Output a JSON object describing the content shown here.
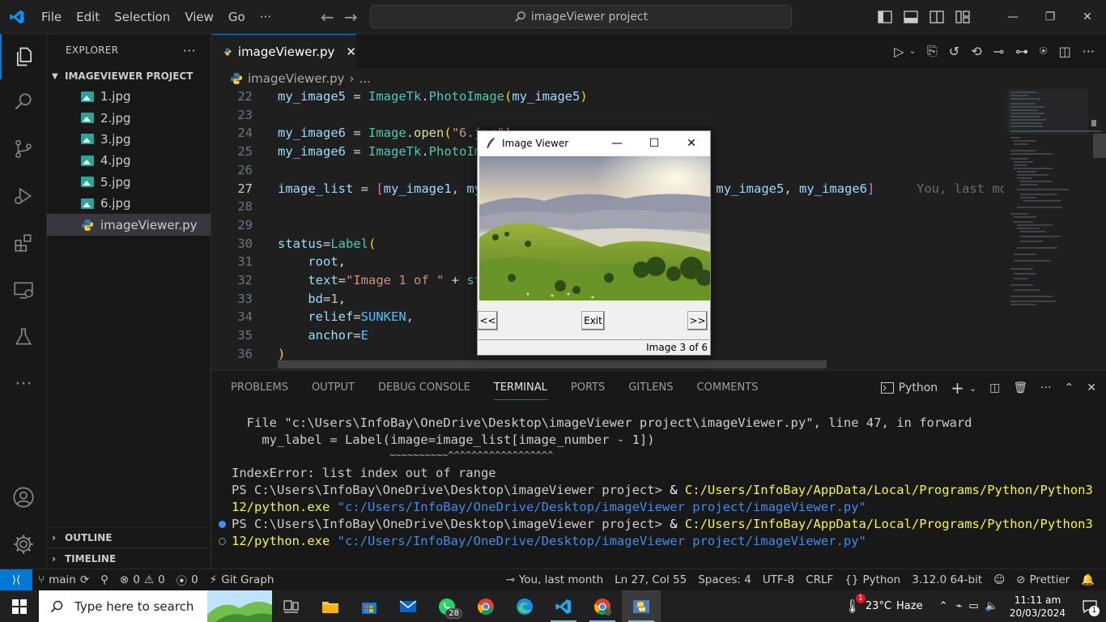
{
  "titlebar": {
    "menu": [
      "File",
      "Edit",
      "Selection",
      "View",
      "Go",
      "···"
    ],
    "search_text": "imageViewer project"
  },
  "sidebar": {
    "title": "EXPLORER",
    "more": "···",
    "project": "IMAGEVIEWER PROJECT",
    "files": [
      "1.jpg",
      "2.jpg",
      "3.jpg",
      "4.jpg",
      "5.jpg",
      "6.jpg",
      "imageViewer.py"
    ],
    "outline": "OUTLINE",
    "timeline": "TIMELINE"
  },
  "editor": {
    "tab_label": "imageViewer.py",
    "breadcrumb_file": "imageViewer.py",
    "breadcrumb_more": "...",
    "line_numbers": [
      "22",
      "23",
      "24",
      "25",
      "26",
      "27",
      "28",
      "29",
      "30",
      "31",
      "32",
      "33",
      "34",
      "35",
      "36"
    ],
    "blame": "You, last mo"
  },
  "image_viewer": {
    "title": "Image Viewer",
    "back": "<<",
    "exit": "Exit",
    "forward": ">>",
    "status": "Image 3 of 6"
  },
  "panel": {
    "tabs": [
      "PROBLEMS",
      "OUTPUT",
      "DEBUG CONSOLE",
      "TERMINAL",
      "PORTS",
      "GITLENS",
      "COMMENTS"
    ],
    "shell": "Python",
    "terminal": {
      "l1": "  File \"c:\\Users\\InfoBay\\OneDrive\\Desktop\\imageViewer project\\imageViewer.py\", line 47, in forward",
      "l2": "    my_label = Label(image=image_list[image_number - 1])",
      "l3": "                           ~~~~~~~~~~^^^^^^^^^^^^^^^^^^",
      "l4": "IndexError: list index out of range",
      "ps1": "PS C:\\Users\\InfoBay\\OneDrive\\Desktop\\imageViewer project> ",
      "amp": "& ",
      "exe_a": "C:/Users/InfoBay/AppData/Local/Programs/Python/Python3",
      "exe_b": "12/python.exe ",
      "arg": "\"c:/Users/InfoBay/OneDrive/Desktop/imageViewer project/imageViewer.py\""
    }
  },
  "statusbar": {
    "branch": "main",
    "errors": "0",
    "warnings": "0",
    "ports": "0",
    "git_graph": "Git Graph",
    "blame": "You, last month",
    "position": "Ln 27, Col 55",
    "spaces": "Spaces: 4",
    "encoding": "UTF-8",
    "eol": "CRLF",
    "language": "Python",
    "interpreter": "3.12.0 64-bit",
    "prettier": "Prettier"
  },
  "taskbar": {
    "search_placeholder": "Type here to search",
    "whatsapp_badge": "28",
    "weather_badge": "1",
    "temperature": "23°C",
    "weather": "Haze",
    "time": "11:11 am",
    "date": "20/03/2024",
    "notifications": "1"
  },
  "colors": {
    "accent": "#0078d4",
    "editor_bg": "#1f1f1f",
    "sidebar_bg": "#181818",
    "selection": "#37373d"
  }
}
